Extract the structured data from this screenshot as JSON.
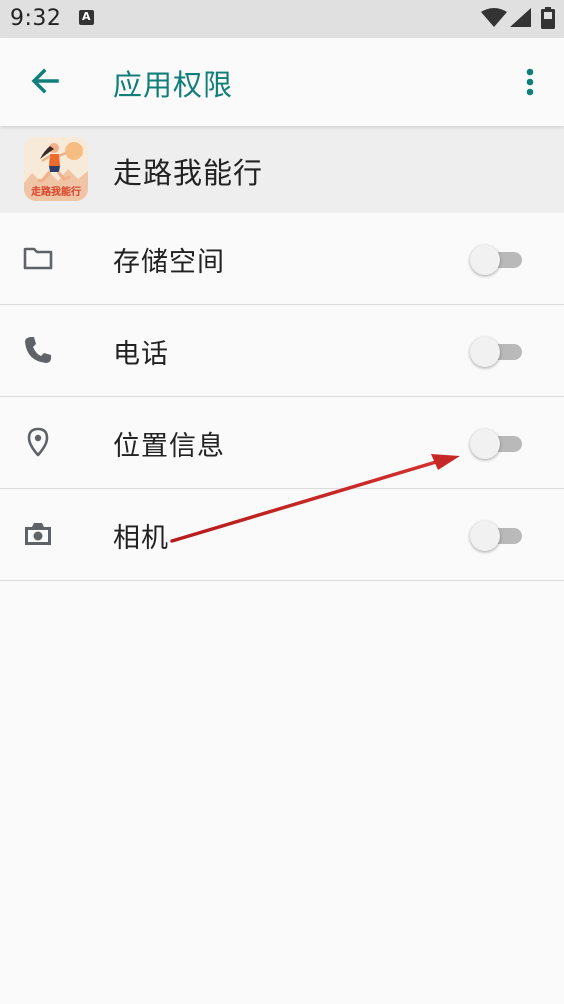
{
  "status_bar": {
    "time": "9:32",
    "notification_icon_letter": "A",
    "icons": [
      "a-notification-icon",
      "wifi-icon",
      "signal-icon",
      "battery-icon"
    ]
  },
  "app_bar": {
    "title": "应用权限",
    "back_icon": "arrow-left-icon",
    "more_icon": "more-vertical-icon"
  },
  "app": {
    "name": "走路我能行",
    "icon_text": "走路我能行"
  },
  "permissions": [
    {
      "label": "存储空间",
      "icon": "folder-icon",
      "enabled": false
    },
    {
      "label": "电话",
      "icon": "phone-icon",
      "enabled": false
    },
    {
      "label": "位置信息",
      "icon": "location-pin-icon",
      "enabled": false
    },
    {
      "label": "相机",
      "icon": "camera-icon",
      "enabled": false
    }
  ],
  "colors": {
    "accent": "#127e7a",
    "status_bar": "#e0e0e0",
    "header_bg": "#eeeeee",
    "annotation_arrow": "#c62828"
  }
}
